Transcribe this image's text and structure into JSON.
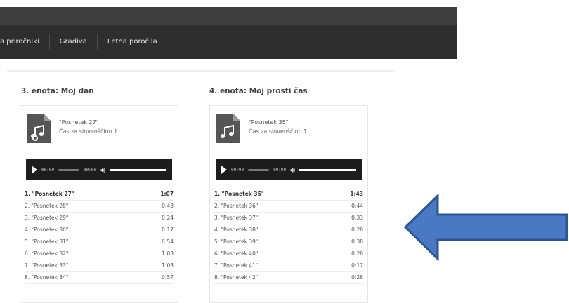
{
  "nav": {
    "items": [
      "a priročniki",
      "Gradiva",
      "Letna poročila"
    ]
  },
  "sections": [
    {
      "title": "3. enota: Moj dan",
      "file_title": "\"Posnetek 27\"",
      "album": "Čas za slovenščino 1",
      "player": {
        "current": "00:00",
        "duration": "00:00"
      },
      "tracks": [
        {
          "name": "1. \"Posnetek 27\"",
          "duration": "1:07"
        },
        {
          "name": "2. \"Posnetek 28\"",
          "duration": "0:43"
        },
        {
          "name": "3. \"Posnetek 29\"",
          "duration": "0:24"
        },
        {
          "name": "4. \"Posnetek 30\"",
          "duration": "0:17"
        },
        {
          "name": "5. \"Posnetek 31\"",
          "duration": "0:54"
        },
        {
          "name": "6. \"Posnetek 32\"",
          "duration": "1:03"
        },
        {
          "name": "7. \"Posnetek 33\"",
          "duration": "1:03"
        },
        {
          "name": "8. \"Posnetek 34\"",
          "duration": "0:57"
        }
      ]
    },
    {
      "title": "4. enota: Moj prosti čas",
      "file_title": "\"Posnetek 35\"",
      "album": "Čas za slovenščino 1",
      "player": {
        "current": "00:00",
        "duration": "00:00"
      },
      "tracks": [
        {
          "name": "1. \"Posnetek 35\"",
          "duration": "1:43"
        },
        {
          "name": "2. \"Posnetek 36\"",
          "duration": "0:44"
        },
        {
          "name": "3. \"Posnetek 37\"",
          "duration": "0:33"
        },
        {
          "name": "4. \"Posnetek 38\"",
          "duration": "0:28"
        },
        {
          "name": "5. \"Posnetek 39\"",
          "duration": "0:38"
        },
        {
          "name": "6. \"Posnetek 40\"",
          "duration": "0:28"
        },
        {
          "name": "7. \"Posnetek 41\"",
          "duration": "0:17"
        },
        {
          "name": "8. \"Posnetek 42\"",
          "duration": "0:28"
        }
      ]
    }
  ],
  "colors": {
    "nav_bg": "#2e2e2e",
    "topbar_bg": "#3f3f3f",
    "player_bg": "#1d1d1d",
    "arrow_fill": "#4a78c2",
    "arrow_stroke": "#2f5590"
  },
  "icons": {
    "file": "music-file-icon",
    "play": "play-icon",
    "volume": "volume-icon",
    "arrow": "left-arrow-icon"
  }
}
